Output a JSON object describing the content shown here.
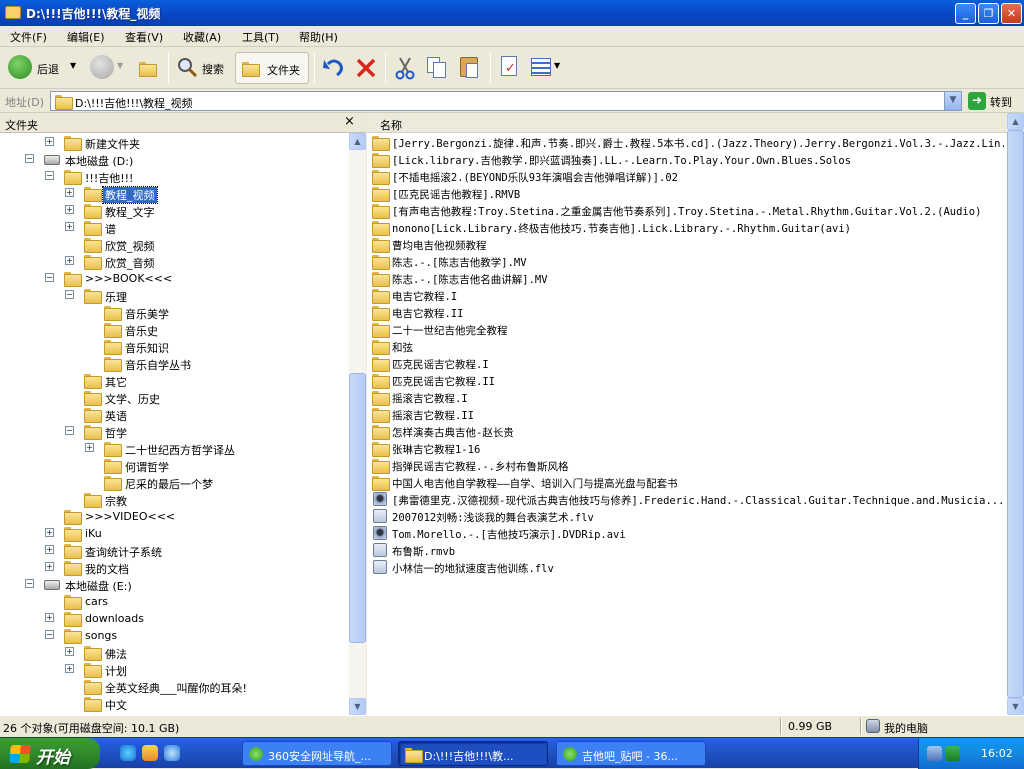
{
  "window": {
    "title": "D:\\!!!吉他!!!\\教程_视频"
  },
  "menu": [
    "文件(F)",
    "编辑(E)",
    "查看(V)",
    "收藏(A)",
    "工具(T)",
    "帮助(H)"
  ],
  "toolbar": {
    "back": "后退",
    "search": "搜索",
    "folders": "文件夹"
  },
  "address": {
    "label": "地址(D)",
    "value": "D:\\!!!吉他!!!\\教程_视频",
    "go": "转到"
  },
  "leftpane": {
    "title": "文件夹",
    "close": "×",
    "tree": [
      {
        "label": "新建文件夹",
        "level": 2,
        "exp": "+",
        "icon": "folder"
      },
      {
        "label": "本地磁盘 (D:)",
        "level": 1,
        "exp": "-",
        "icon": "drive"
      },
      {
        "label": "!!!吉他!!!",
        "level": 2,
        "exp": "-",
        "icon": "folder"
      },
      {
        "label": "教程_视频",
        "level": 3,
        "exp": "+",
        "icon": "folder",
        "selected": true
      },
      {
        "label": "教程_文字",
        "level": 3,
        "exp": "+",
        "icon": "folder"
      },
      {
        "label": "谱",
        "level": 3,
        "exp": "+",
        "icon": "folder"
      },
      {
        "label": "欣赏_视频",
        "level": 3,
        "exp": "",
        "icon": "folder"
      },
      {
        "label": "欣赏_音频",
        "level": 3,
        "exp": "+",
        "icon": "folder"
      },
      {
        "label": ">>>BOOK<<<",
        "level": 2,
        "exp": "-",
        "icon": "folder"
      },
      {
        "label": "乐理",
        "level": 3,
        "exp": "-",
        "icon": "folder"
      },
      {
        "label": "音乐美学",
        "level": 4,
        "exp": "",
        "icon": "folder"
      },
      {
        "label": "音乐史",
        "level": 4,
        "exp": "",
        "icon": "folder"
      },
      {
        "label": "音乐知识",
        "level": 4,
        "exp": "",
        "icon": "folder"
      },
      {
        "label": "音乐自学丛书",
        "level": 4,
        "exp": "",
        "icon": "folder"
      },
      {
        "label": "其它",
        "level": 3,
        "exp": "",
        "icon": "folder"
      },
      {
        "label": "文学、历史",
        "level": 3,
        "exp": "",
        "icon": "folder"
      },
      {
        "label": "英语",
        "level": 3,
        "exp": "",
        "icon": "folder"
      },
      {
        "label": "哲学",
        "level": 3,
        "exp": "-",
        "icon": "folder"
      },
      {
        "label": "二十世纪西方哲学译丛",
        "level": 4,
        "exp": "+",
        "icon": "folder"
      },
      {
        "label": "何谓哲学",
        "level": 4,
        "exp": "",
        "icon": "folder"
      },
      {
        "label": "尼采的最后一个梦",
        "level": 4,
        "exp": "",
        "icon": "folder"
      },
      {
        "label": "宗教",
        "level": 3,
        "exp": "",
        "icon": "folder"
      },
      {
        "label": ">>>VIDEO<<<",
        "level": 2,
        "exp": "",
        "icon": "folder"
      },
      {
        "label": "iKu",
        "level": 2,
        "exp": "+",
        "icon": "folder"
      },
      {
        "label": "查询统计子系统",
        "level": 2,
        "exp": "+",
        "icon": "folder"
      },
      {
        "label": "我的文档",
        "level": 2,
        "exp": "+",
        "icon": "folder"
      },
      {
        "label": "本地磁盘 (E:)",
        "level": 1,
        "exp": "-",
        "icon": "drive"
      },
      {
        "label": "cars",
        "level": 2,
        "exp": "",
        "icon": "folder"
      },
      {
        "label": "downloads",
        "level": 2,
        "exp": "+",
        "icon": "folder"
      },
      {
        "label": "songs",
        "level": 2,
        "exp": "-",
        "icon": "folder"
      },
      {
        "label": "佛法",
        "level": 3,
        "exp": "+",
        "icon": "folder"
      },
      {
        "label": "计划",
        "level": 3,
        "exp": "+",
        "icon": "folder"
      },
      {
        "label": "全英文经典___叫醒你的耳朵!",
        "level": 3,
        "exp": "",
        "icon": "folder"
      },
      {
        "label": "中文",
        "level": 3,
        "exp": "",
        "icon": "folder"
      }
    ]
  },
  "rightpane": {
    "column": "名称",
    "files": [
      {
        "name": "[Jerry.Bergonzi.旋律.和声.节奏.即兴.爵士.教程.5本书.cd].(Jazz.Theory).Jerry.Bergonzi.Vol.3.-.Jazz.Lin...",
        "icon": "folder"
      },
      {
        "name": "[Lick.library.吉他教学.即兴蓝调独奏].LL.-.Learn.To.Play.Your.Own.Blues.Solos",
        "icon": "folder"
      },
      {
        "name": "[不插电摇滚2.(BEYOND乐队93年演唱会吉他弹唱详解)].02",
        "icon": "folder"
      },
      {
        "name": "[匹克民谣吉他教程].RMVB",
        "icon": "folder"
      },
      {
        "name": "[有声电吉他教程:Troy.Stetina.之重金属吉他节奏系列].Troy.Stetina.-.Metal.Rhythm.Guitar.Vol.2.(Audio)",
        "icon": "folder"
      },
      {
        "name": "nonono[Lick.Library.终极吉他技巧.节奏吉他].Lick.Library.-.Rhythm.Guitar(avi)",
        "icon": "folder"
      },
      {
        "name": "曹均电吉他视频教程",
        "icon": "folder"
      },
      {
        "name": "陈志.-.[陈志吉他教学].MV",
        "icon": "folder"
      },
      {
        "name": "陈志.-.[陈志吉他名曲讲解].MV",
        "icon": "folder"
      },
      {
        "name": "电吉它教程.I",
        "icon": "folder"
      },
      {
        "name": "电吉它教程.II",
        "icon": "folder"
      },
      {
        "name": "二十一世纪吉他完全教程",
        "icon": "folder"
      },
      {
        "name": "和弦",
        "icon": "folder"
      },
      {
        "name": "匹克民谣吉它教程.I",
        "icon": "folder"
      },
      {
        "name": "匹克民谣吉它教程.II",
        "icon": "folder"
      },
      {
        "name": "摇滚吉它教程.I",
        "icon": "folder"
      },
      {
        "name": "摇滚吉它教程.II",
        "icon": "folder"
      },
      {
        "name": "怎样演奏古典吉他-赵长贵",
        "icon": "folder"
      },
      {
        "name": "张琳吉它教程1-16",
        "icon": "folder"
      },
      {
        "name": "指弹民谣吉它教程.-.乡村布鲁斯风格",
        "icon": "folder"
      },
      {
        "name": "中国人电吉他自学教程——自学、培训入门与提高光盘与配套书",
        "icon": "folder"
      },
      {
        "name": "[弗雷德里克.汉德视频-现代派古典吉他技巧与修养].Frederic.Hand.-.Classical.Guitar.Technique.and.Musicia...",
        "icon": "video"
      },
      {
        "name": "2007012刘畅:浅谈我的舞台表演艺术.flv",
        "icon": "file"
      },
      {
        "name": "Tom.Morello.-.[吉他技巧演示].DVDRip.avi",
        "icon": "video"
      },
      {
        "name": "布鲁斯.rmvb",
        "icon": "file"
      },
      {
        "name": "小林信一的地狱速度吉他训练.flv",
        "icon": "file"
      }
    ]
  },
  "status": {
    "count": "26 个对象(可用磁盘空间: 10.1 GB)",
    "size": "0.99 GB",
    "location": "我的电脑"
  },
  "taskbar": {
    "start": "开始",
    "tasks": [
      {
        "label": "360安全网址导航_...",
        "active": false
      },
      {
        "label": "D:\\!!!吉他!!!\\教...",
        "active": true
      },
      {
        "label": "吉他吧_贴吧 - 36...",
        "active": false
      }
    ],
    "clock": "16:02"
  }
}
